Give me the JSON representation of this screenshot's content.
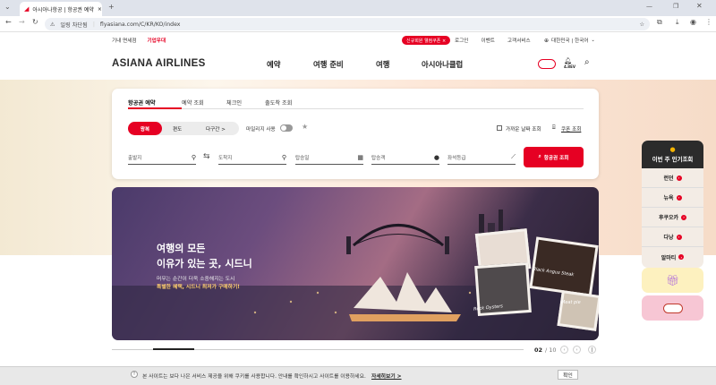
{
  "browser": {
    "tab_title": "아시아나항공 | 항공권 예약",
    "new_tab": "+",
    "security_label": "일링 차단됨",
    "url": "flyasiana.com/C/KR/KO/index"
  },
  "topnav": {
    "links": [
      "기내 면세점",
      "기업우대"
    ],
    "promo_badge": "신규회원 웰컴쿠폰 ×",
    "login": "로그인",
    "event": "이벤트",
    "service": "고객서비스",
    "locale": "대한민국 | 한국어"
  },
  "header": {
    "logo": "ASIANA AIRLINES",
    "menu": [
      "예약",
      "여행 준비",
      "여행",
      "아시아나클럽"
    ],
    "badge_label": "4.8EV"
  },
  "booking": {
    "tabs": [
      "항공권 예약",
      "예약 조회",
      "체크인",
      "출도착 조회"
    ],
    "trip_types": [
      "왕복",
      "편도",
      "다구간 >"
    ],
    "mileage": "마일리지 사용",
    "flex_date": "가까운 날짜 조회",
    "coupon": "쿠폰 조회",
    "departure": "출발지",
    "arrival": "도착지",
    "date": "탑승일",
    "passengers": "탑승객",
    "seat_class": "좌석등급",
    "search": "항공권 조회"
  },
  "banner": {
    "headline_1": "여행의 모든",
    "headline_2": "이유가 있는 곳, 시드니",
    "sub_1": "머무는 순간이 더욱 소중해지는 도시",
    "sub_2": "특별한 혜택, 시드니 최저가 구매하기!",
    "photo_labels": [
      "Black Angus Steak",
      "Rock Oysters",
      "Meat pie"
    ],
    "page_current": "02",
    "page_total": "/ 10",
    "progress": 0.1
  },
  "popular": {
    "title": "이번 주 인기조회",
    "cities": [
      "런던",
      "뉴욕",
      "후쿠오카",
      "다낭",
      "알마티"
    ]
  },
  "cookie": {
    "text": "본 사이트는 보다 나은 서비스 제공을 위해 쿠키를 사용합니다. 안내를 확인하시고 사이트를 이용하세요.",
    "link": "자세히보기 >",
    "confirm": "확인"
  },
  "colors": {
    "brand_red": "#e60023",
    "dark": "#2b2b2b"
  }
}
